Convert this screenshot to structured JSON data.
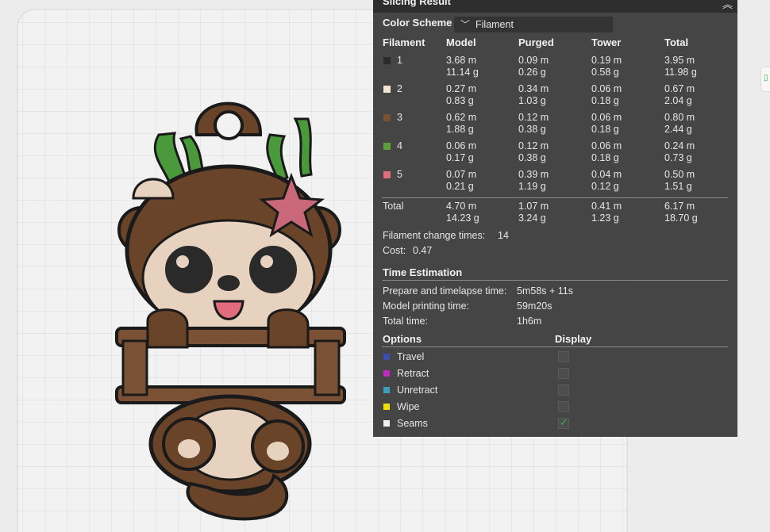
{
  "panel": {
    "title": "Slicing Result",
    "color_scheme_label": "Color Scheme",
    "color_scheme_value": "Filament"
  },
  "table": {
    "headers": [
      "Filament",
      "Model",
      "Purged",
      "Tower",
      "Total"
    ],
    "rows": [
      {
        "id": "1",
        "color": "#2b2b2b",
        "model_m": "3.68 m",
        "model_g": "11.14 g",
        "purged_m": "0.09 m",
        "purged_g": "0.26 g",
        "tower_m": "0.19 m",
        "tower_g": "0.58 g",
        "total_m": "3.95 m",
        "total_g": "11.98 g"
      },
      {
        "id": "2",
        "color": "#f2e2d2",
        "model_m": "0.27 m",
        "model_g": "0.83 g",
        "purged_m": "0.34 m",
        "purged_g": "1.03 g",
        "tower_m": "0.06 m",
        "tower_g": "0.18 g",
        "total_m": "0.67 m",
        "total_g": "2.04 g"
      },
      {
        "id": "3",
        "color": "#7a5134",
        "model_m": "0.62 m",
        "model_g": "1.88 g",
        "purged_m": "0.12 m",
        "purged_g": "0.38 g",
        "tower_m": "0.06 m",
        "tower_g": "0.18 g",
        "total_m": "0.80 m",
        "total_g": "2.44 g"
      },
      {
        "id": "4",
        "color": "#5e9e3a",
        "model_m": "0.06 m",
        "model_g": "0.17 g",
        "purged_m": "0.12 m",
        "purged_g": "0.38 g",
        "tower_m": "0.06 m",
        "tower_g": "0.18 g",
        "total_m": "0.24 m",
        "total_g": "0.73 g"
      },
      {
        "id": "5",
        "color": "#e06c7c",
        "model_m": "0.07 m",
        "model_g": "0.21 g",
        "purged_m": "0.39 m",
        "purged_g": "1.19 g",
        "tower_m": "0.04 m",
        "tower_g": "0.12 g",
        "total_m": "0.50 m",
        "total_g": "1.51 g"
      }
    ],
    "total": {
      "label": "Total",
      "model_m": "4.70 m",
      "model_g": "14.23 g",
      "purged_m": "1.07 m",
      "purged_g": "3.24 g",
      "tower_m": "0.41 m",
      "tower_g": "1.23 g",
      "total_m": "6.17 m",
      "total_g": "18.70 g"
    }
  },
  "summary": {
    "change_label": "Filament change times:",
    "change_value": "14",
    "cost_label": "Cost:",
    "cost_value": "0.47"
  },
  "time": {
    "heading": "Time Estimation",
    "rows": [
      {
        "label": "Prepare and timelapse time:",
        "value": "5m58s + 11s"
      },
      {
        "label": "Model printing time:",
        "value": "59m20s"
      },
      {
        "label": "Total time:",
        "value": "1h6m"
      }
    ]
  },
  "options": {
    "heading": "Options",
    "display_heading": "Display",
    "items": [
      {
        "label": "Travel",
        "color": "#3a4fb0",
        "checked": false
      },
      {
        "label": "Retract",
        "color": "#c02ac0",
        "checked": false
      },
      {
        "label": "Unretract",
        "color": "#3aa0c0",
        "checked": false
      },
      {
        "label": "Wipe",
        "color": "#f0e000",
        "checked": false
      },
      {
        "label": "Seams",
        "color": "#f0f0f0",
        "checked": true
      }
    ]
  },
  "icons": {
    "collapse": "collapse-up-icon",
    "dropdown": "chevron-down-icon",
    "check": "check-icon"
  }
}
